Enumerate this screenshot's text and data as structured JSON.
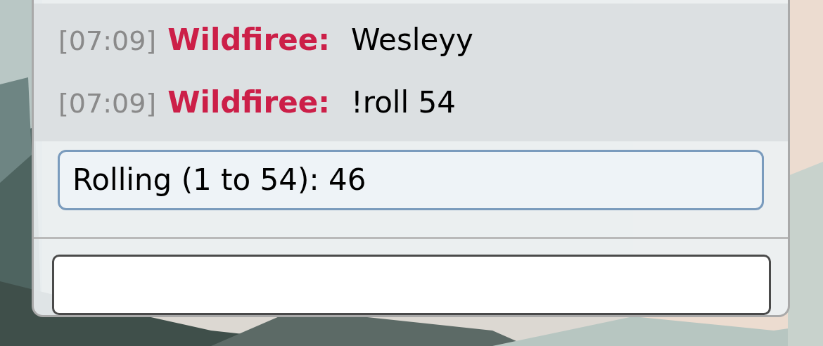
{
  "messages": [
    {
      "time": "[07:09]",
      "user": "Wildfiree:",
      "text": "Wesleyy"
    },
    {
      "time": "[07:09]",
      "user": "Wildfiree:",
      "text": "!roll 54"
    }
  ],
  "system_message": {
    "text": "Rolling (1 to 54): 46"
  }
}
